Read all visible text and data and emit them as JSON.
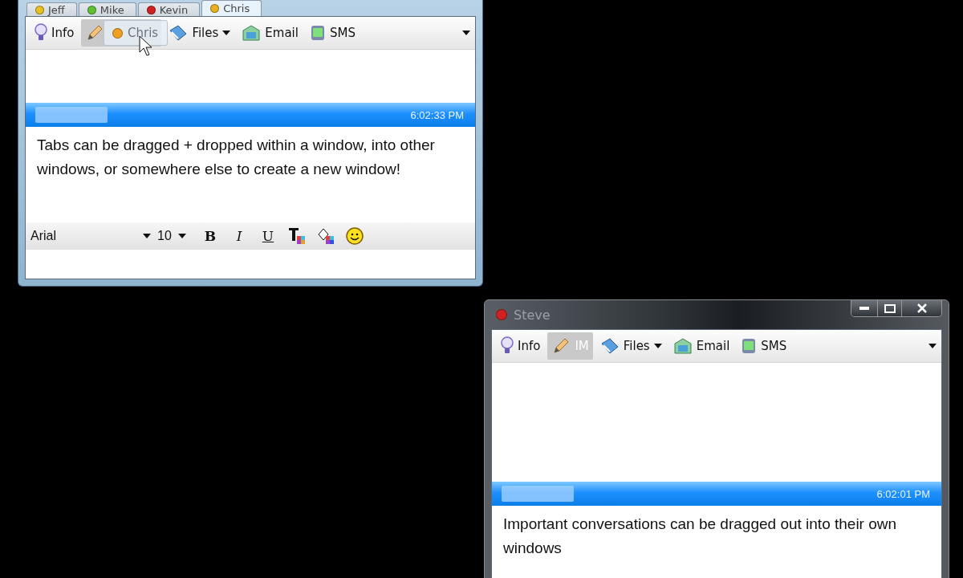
{
  "windows": [
    {
      "kind": "tabbed",
      "tabs": [
        {
          "label": "Jeff",
          "color": "#e8c020",
          "selected": false
        },
        {
          "label": "Mike",
          "color": "#60c030",
          "selected": false
        },
        {
          "label": "Kevin",
          "color": "#d02020",
          "selected": false
        },
        {
          "label": "Chris",
          "color": "#e8b020",
          "selected": true
        }
      ],
      "drag_tab": {
        "label": "Chris",
        "color": "#f0a020"
      },
      "toolbar": [
        {
          "kind": "info",
          "label": "Info",
          "selected": false,
          "dropdown": false
        },
        {
          "kind": "im",
          "selected": true,
          "dropdown": false
        },
        {
          "kind": "files",
          "label": "Files",
          "selected": false,
          "dropdown": true
        },
        {
          "kind": "email",
          "label": "Email",
          "selected": false,
          "dropdown": false
        },
        {
          "kind": "sms",
          "label": "SMS",
          "selected": false,
          "dropdown": false
        }
      ],
      "message": {
        "time": "6:02:33 PM",
        "text": "Tabs can be dragged + dropped within a window, into other windows, or somewhere else to create a new window!"
      },
      "format_bar": {
        "font": "Arial",
        "size": "10",
        "buttons": [
          {
            "kind": "bold",
            "label": "B"
          },
          {
            "kind": "italic",
            "label": "I"
          },
          {
            "kind": "underline",
            "label": "U"
          },
          {
            "kind": "text-color"
          },
          {
            "kind": "fill-color"
          },
          {
            "kind": "emoticon"
          }
        ]
      }
    },
    {
      "kind": "single",
      "title": "Steve",
      "status_dot": {
        "color": "#d02020"
      },
      "toolbar": [
        {
          "kind": "info",
          "label": "Info",
          "selected": false,
          "dropdown": false
        },
        {
          "kind": "im",
          "label": "IM",
          "selected": true,
          "dropdown": false
        },
        {
          "kind": "files",
          "label": "Files",
          "selected": false,
          "dropdown": true
        },
        {
          "kind": "email",
          "label": "Email",
          "selected": false,
          "dropdown": false
        },
        {
          "kind": "sms",
          "label": "SMS",
          "selected": false,
          "dropdown": false
        }
      ],
      "message": {
        "time": "6:02:01 PM",
        "text": "Important conversations can be dragged out into their own windows"
      }
    }
  ]
}
